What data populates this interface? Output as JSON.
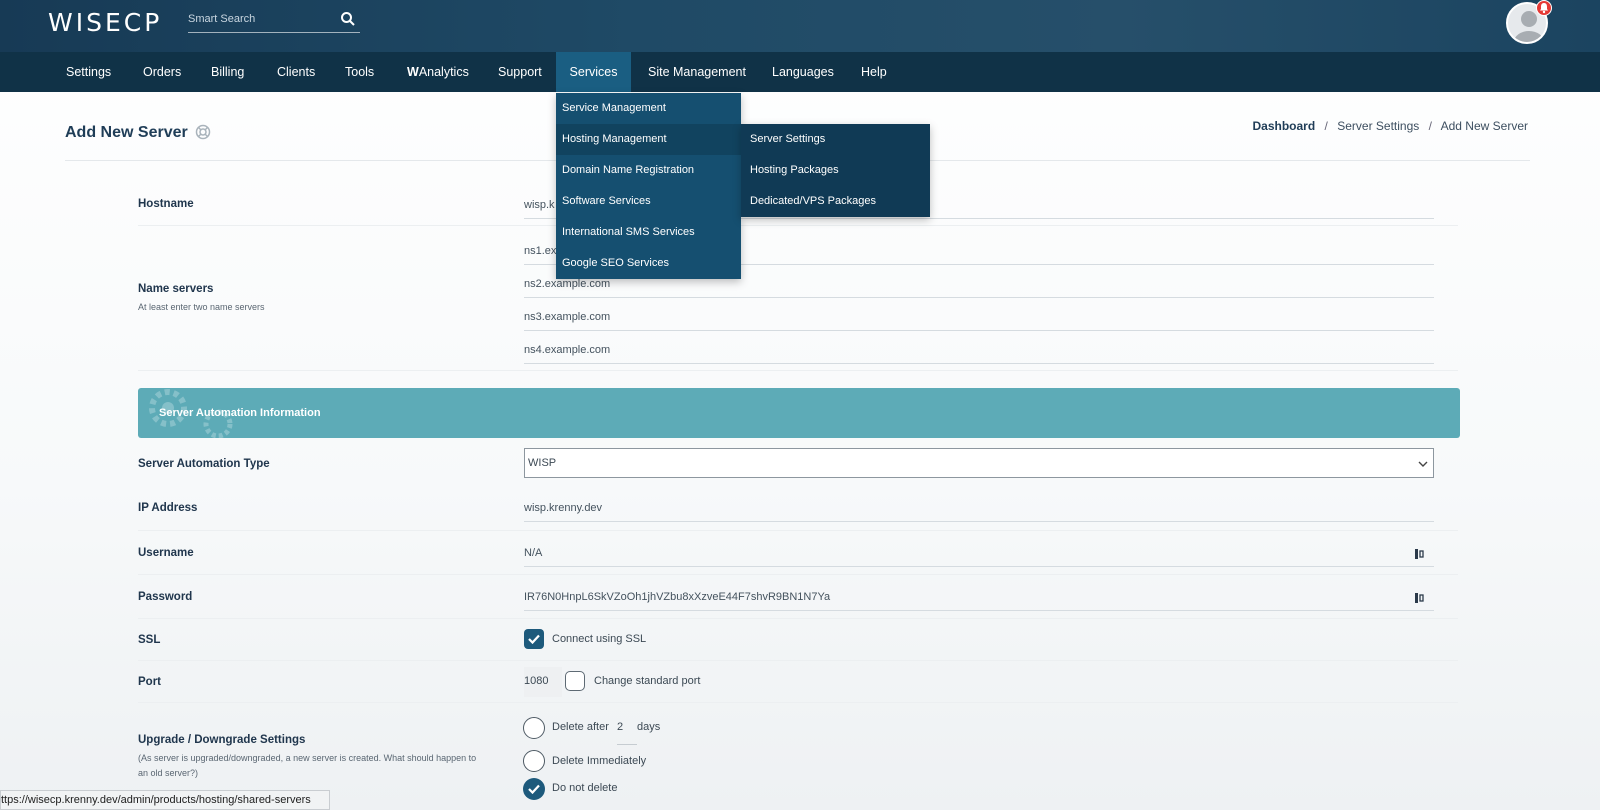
{
  "header": {
    "logo": "WISECP",
    "search_placeholder": "Smart Search"
  },
  "nav": {
    "items": [
      "Settings",
      "Orders",
      "Billing",
      "Clients",
      "Tools",
      "WAnalytics",
      "Support",
      "Services",
      "Site Management",
      "Languages",
      "Help"
    ],
    "active": "Services"
  },
  "services_menu": {
    "items": [
      "Service Management",
      "Hosting Management",
      "Domain Name Registration",
      "Software Services",
      "International SMS Services",
      "Google SEO Services"
    ],
    "hover": "Hosting Management",
    "submenu": [
      "Server Settings",
      "Hosting Packages",
      "Dedicated/VPS Packages"
    ]
  },
  "page": {
    "title": "Add New Server",
    "breadcrumb": [
      "Dashboard",
      "Server Settings",
      "Add New Server"
    ]
  },
  "form": {
    "hostname": {
      "label": "Hostname",
      "value": "wisp.k"
    },
    "name_servers": {
      "label": "Name servers",
      "hint": "At least enter two name servers",
      "values": [
        "ns1.ex",
        "ns2.example.com",
        "ns3.example.com",
        "ns4.example.com"
      ]
    },
    "section_title": "Server Automation Information",
    "automation_type": {
      "label": "Server Automation Type",
      "value": "WISP"
    },
    "ip_address": {
      "label": "IP Address",
      "value": "wisp.krenny.dev"
    },
    "username": {
      "label": "Username",
      "value": "N/A"
    },
    "password": {
      "label": "Password",
      "value": "IR76N0HnpL6SkVZoOh1jhVZbu8xXzveE44F7shvR9BN1N7Ya"
    },
    "ssl": {
      "label": "SSL",
      "option": "Connect using SSL",
      "checked": true
    },
    "port": {
      "label": "Port",
      "value": "1080",
      "option": "Change standard port",
      "checked": false
    },
    "upgrade": {
      "label": "Upgrade / Downgrade Settings",
      "hint": "(As server is upgraded/downgraded, a new server is created. What should happen to an old server?)",
      "delete_after_prefix": "Delete after",
      "delete_after_value": "2",
      "delete_after_suffix": "days",
      "delete_immediately": "Delete Immediately",
      "do_not_delete": "Do not delete",
      "selected": "Do not delete"
    }
  },
  "status_url": "ttps://wisecp.krenny.dev/admin/products/hosting/shared-servers",
  "colors": {
    "topbar": "#1f4a66",
    "nav": "#103247",
    "accent": "#1a5e82",
    "section_bar": "#5dabb7",
    "check": "#1d5a7c",
    "notification": "#e53935"
  }
}
